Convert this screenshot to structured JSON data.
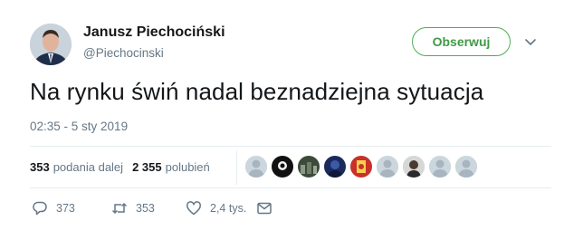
{
  "author": {
    "name": "Janusz Piechociński",
    "handle": "@Piechocinski"
  },
  "follow_button": {
    "label": "Obserwuj"
  },
  "tweet": {
    "text": "Na rynku świń nadal beznadziejna sytuacja",
    "timestamp": "02:35 - 5 sty 2019"
  },
  "stats": {
    "retweets_count": "353",
    "retweets_label": "podania dalej",
    "likes_count": "2 355",
    "likes_label": "polubień"
  },
  "likers": [
    {
      "kind": "default"
    },
    {
      "kind": "dark"
    },
    {
      "kind": "crowd"
    },
    {
      "kind": "dark-blue"
    },
    {
      "kind": "red"
    },
    {
      "kind": "default"
    },
    {
      "kind": "photo"
    },
    {
      "kind": "default"
    },
    {
      "kind": "default"
    }
  ],
  "actions": {
    "replies": "373",
    "retweets": "353",
    "likes": "2,4 tys."
  },
  "colors": {
    "accent_green": "#4caf50",
    "secondary_text": "#657786",
    "divider": "#e6ecf0"
  }
}
